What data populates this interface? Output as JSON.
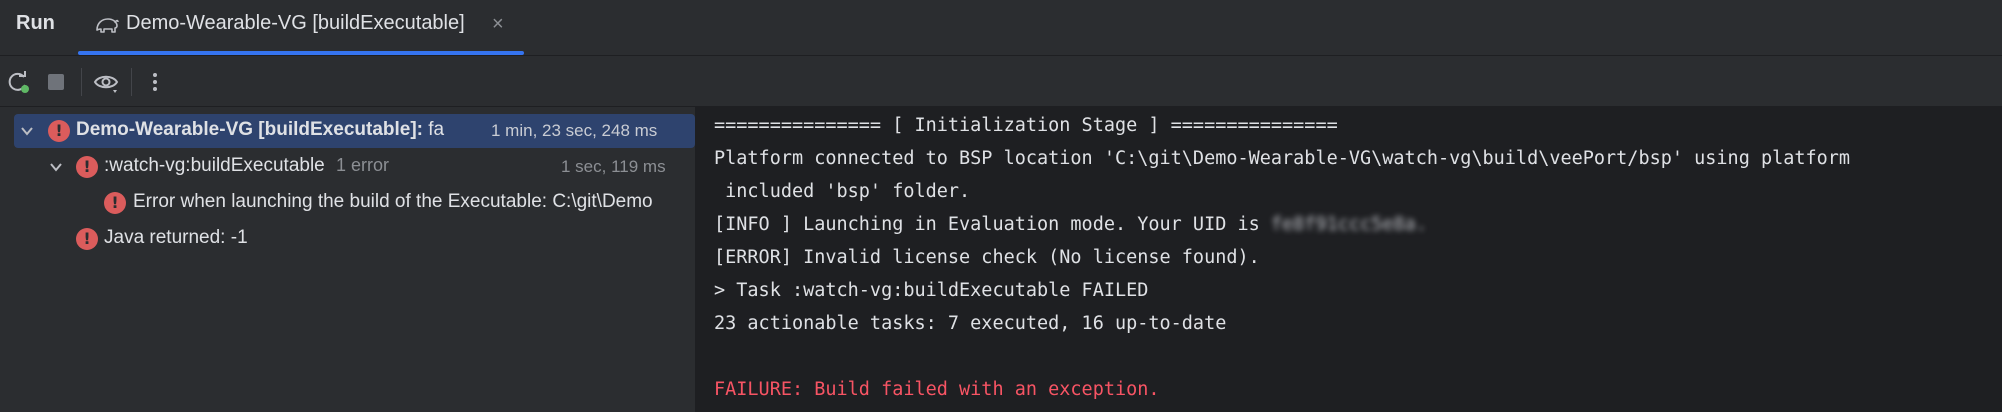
{
  "header": {
    "run_title": "Run",
    "tab": {
      "label": "Demo-Wearable-VG [buildExecutable]",
      "close_glyph": "×",
      "icon": "gradle-elephant-icon"
    }
  },
  "toolbar": {
    "buttons": [
      {
        "name": "rerun-button",
        "icon": "rerun-icon"
      },
      {
        "name": "stop-button",
        "icon": "stop-icon"
      },
      {
        "name": "view-options-button",
        "icon": "eye-icon"
      },
      {
        "name": "more-button",
        "icon": "more-vertical-icon"
      }
    ]
  },
  "tree": {
    "rows": [
      {
        "label": "Demo-Wearable-VG [buildExecutable]:",
        "suffix": " fa",
        "time": "1 min, 23 sec, 248 ms",
        "status": "error",
        "expanded": true,
        "selected": true
      },
      {
        "label": ":watch-vg:buildExecutable",
        "suffix": "1 error",
        "time": "1 sec, 119 ms",
        "status": "error",
        "expanded": true
      },
      {
        "label": "Error when launching the build of the Executable: C:\\git\\Demo",
        "status": "error"
      },
      {
        "label": "Java returned: -1",
        "status": "error"
      }
    ]
  },
  "console": {
    "lines": [
      {
        "text": "=============== [ Initialization Stage ] ===============",
        "kind": "normal"
      },
      {
        "text": "Platform connected to BSP location 'C:\\git\\Demo-Wearable-VG\\watch-vg\\build\\veePort/bsp' using platform",
        "kind": "normal"
      },
      {
        "text": " included 'bsp' folder.",
        "kind": "normal"
      },
      {
        "text": "[INFO ] Launching in Evaluation mode. Your UID is ",
        "uid": "fe8f91ccc5e8a.",
        "kind": "normal"
      },
      {
        "text": "[ERROR] Invalid license check (No license found).",
        "kind": "normal"
      },
      {
        "text": "> Task :watch-vg:buildExecutable FAILED",
        "kind": "normal"
      },
      {
        "text": "23 actionable tasks: 7 executed, 16 up-to-date",
        "kind": "normal"
      },
      {
        "text": "",
        "kind": "normal"
      },
      {
        "text": "FAILURE: Build failed with an exception.",
        "kind": "error"
      }
    ]
  },
  "colors": {
    "accent": "#3574f0",
    "error": "#db5c5c",
    "error_text": "#f75464",
    "selection": "#2e436e"
  }
}
